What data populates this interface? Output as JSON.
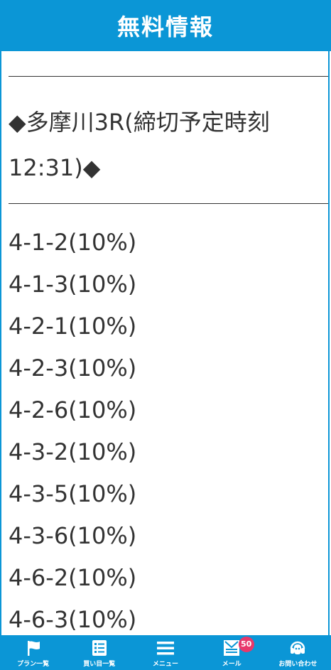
{
  "header": {
    "title": "無料情報"
  },
  "race": {
    "line1": "◆多摩川3R(締切予定時刻",
    "line2": "12:31)◆"
  },
  "picks": [
    "4-1-2(10%)",
    "4-1-3(10%)",
    "4-2-1(10%)",
    "4-2-3(10%)",
    "4-2-6(10%)",
    "4-3-2(10%)",
    "4-3-5(10%)",
    "4-3-6(10%)",
    "4-6-2(10%)",
    "4-6-3(10%)"
  ],
  "tabbar": {
    "plans": {
      "label": "プラン一覧",
      "icon": "flag-icon"
    },
    "bets": {
      "label": "買い目一覧",
      "icon": "list-icon"
    },
    "menu": {
      "label": "メニュー",
      "icon": "hamburger-icon"
    },
    "mail": {
      "label": "メール",
      "icon": "mail-icon",
      "badge": "50"
    },
    "contact": {
      "label": "お問い合わせ",
      "icon": "headset-icon"
    }
  },
  "colors": {
    "brand": "#0b96d6",
    "badge": "#e8386b"
  }
}
